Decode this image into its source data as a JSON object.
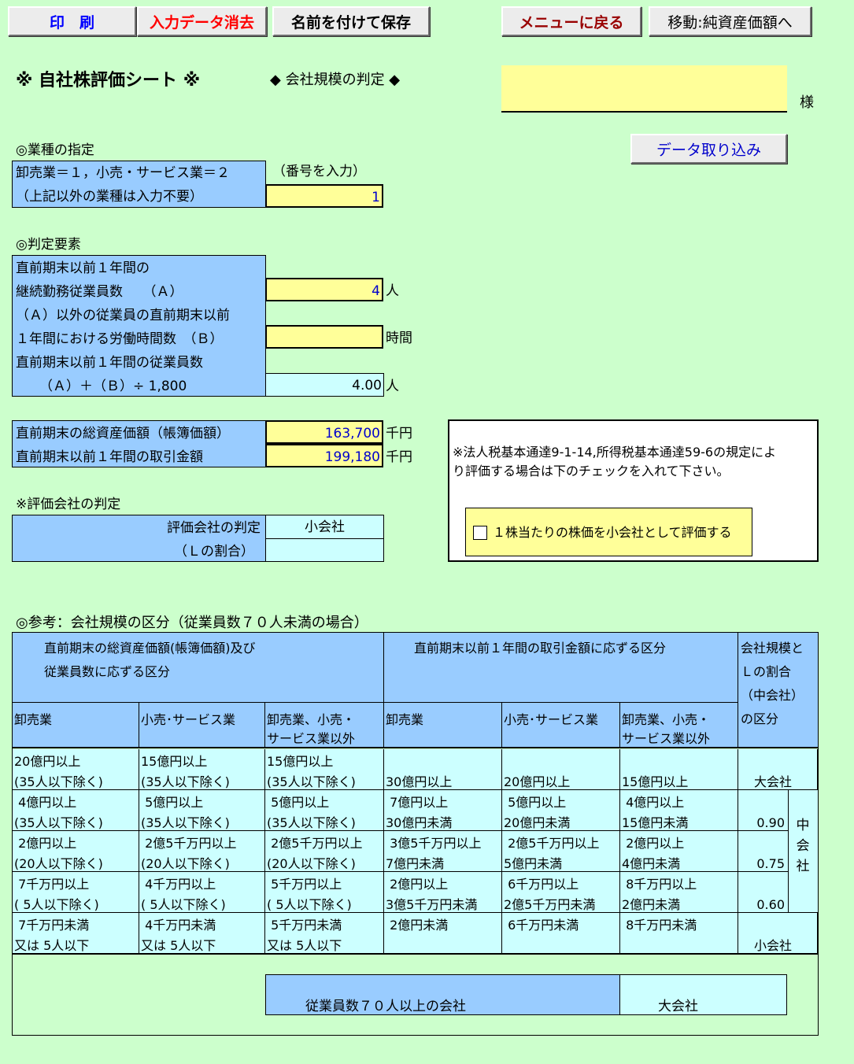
{
  "toolbar": {
    "print": "印　刷",
    "clear": "入力データ消去",
    "save_as": "名前を付けて保存",
    "menu": "メニューに戻る",
    "move": "移動:純資産価額へ"
  },
  "header": {
    "title": "※ 自社株評価シート ※",
    "subtitle": "◆ 会社規模の判定 ◆",
    "company_name_value": "",
    "honorific": "様"
  },
  "import_button": "データ取り込み",
  "industry": {
    "heading": "◎業種の指定",
    "label_line1": "卸売業＝１，小売・サービス業＝２",
    "label_line2": "（上記以外の業種は入力不要）",
    "hint": "（番号を入力）",
    "value": "1"
  },
  "factors": {
    "heading": "◎判定要素",
    "a_line1": "直前期末以前１年間の",
    "a_line2": "継続勤務従業員数　　（Ａ）",
    "a_value": "4",
    "a_unit": "人",
    "b_line1": "（Ａ）以外の従業員の直前期末以前",
    "b_line2": "１年間における労働時間数　（Ｂ）",
    "b_value": "",
    "b_unit": "時間",
    "c_line1": "直前期末以前１年間の従業員数",
    "c_line2": "（Ａ）＋（Ｂ）÷ 1,800",
    "c_value": "4.00",
    "c_unit": "人"
  },
  "amounts": {
    "assets_label": "直前期末の総資産価額（帳簿価額）",
    "assets_value": "163,700",
    "assets_unit": "千円",
    "sales_label": "直前期末以前１年間の取引金額",
    "sales_value": "199,180",
    "sales_unit": "千円"
  },
  "notice": {
    "text_line1": "※法人税基本通達9-1-14,所得税基本通達59-6の規定によ",
    "text_line2": "り評価する場合は下のチェックを入れて下さい。",
    "checkbox_label": "１株当たりの株価を小会社として評価する",
    "checked": false
  },
  "result": {
    "heading": "※評価会社の判定",
    "judgement_label": "評価会社の判定",
    "judgement_value": "小会社",
    "ratio_label": "（Ｌの割合）",
    "ratio_value": ""
  },
  "reference": {
    "heading": "◎参考：会社規模の区分（従業員数７０人未満の場合）",
    "group1_line1": "直前期末の総資産価額(帳簿価額)及び",
    "group1_line2": "従業員数に応ずる区分",
    "group2": "直前期末以前１年間の取引金額に応ずる区分",
    "group3_line1": "会社規模と",
    "group3_line2": "Ｌの割合",
    "group3_line3": "（中会社）",
    "group3_line4": "の区分",
    "sub_headers": [
      [
        "卸売業",
        ""
      ],
      [
        "小売･サービス業",
        ""
      ],
      [
        "卸売業、小売・",
        "サービス業以外"
      ],
      [
        "卸売業",
        ""
      ],
      [
        "小売･サービス業",
        ""
      ],
      [
        "卸売業、小売・",
        "サービス業以外"
      ]
    ],
    "rows": [
      {
        "cells": [
          [
            "20億円以上",
            "(35人以下除く)"
          ],
          [
            "15億円以上",
            "(35人以下除く)"
          ],
          [
            "15億円以上",
            "(35人以下除く)"
          ],
          [
            "",
            "30億円以上"
          ],
          [
            "",
            "20億円以上"
          ],
          [
            "",
            "15億円以上"
          ]
        ],
        "size": "大会社",
        "ratio": ""
      },
      {
        "cells": [
          [
            " 4億円以上",
            "(35人以下除く)"
          ],
          [
            " 5億円以上",
            "(35人以下除く)"
          ],
          [
            " 5億円以上",
            "(35人以下除く)"
          ],
          [
            " 7億円以上",
            "30億円未満"
          ],
          [
            " 5億円以上",
            "20億円未満"
          ],
          [
            " 4億円以上",
            "15億円未満"
          ]
        ],
        "size": "",
        "ratio": "0.90"
      },
      {
        "cells": [
          [
            " 2億円以上",
            "(20人以下除く)"
          ],
          [
            " 2億5千万円以上",
            "(20人以下除く)"
          ],
          [
            " 2億5千万円以上",
            "(20人以下除く)"
          ],
          [
            " 3億5千万円以上",
            "7億円未満"
          ],
          [
            " 2億5千万円以上",
            "5億円未満"
          ],
          [
            " 2億円以上",
            "4億円未満"
          ]
        ],
        "size": "",
        "ratio": "0.75"
      },
      {
        "cells": [
          [
            " 7千万円以上",
            "( 5人以下除く)"
          ],
          [
            " 4千万円以上",
            "( 5人以下除く)"
          ],
          [
            " 5千万円以上",
            "( 5人以下除く)"
          ],
          [
            " 2億円以上",
            "3億5千万円未満"
          ],
          [
            " 6千万円以上",
            "2億5千万円未満"
          ],
          [
            " 8千万円以上",
            "2億円未満"
          ]
        ],
        "size": "",
        "ratio": "0.60"
      },
      {
        "cells": [
          [
            " 7千万円未満",
            "又は 5人以下"
          ],
          [
            " 4千万円未満",
            "又は 5人以下"
          ],
          [
            " 5千万円未満",
            "又は 5人以下"
          ],
          [
            " 2億円未満",
            ""
          ],
          [
            " 6千万円未満",
            ""
          ],
          [
            " 8千万円未満",
            ""
          ]
        ],
        "size": "小会社",
        "ratio": ""
      }
    ],
    "middle_label": "中会社",
    "over70_label": "従業員数７０人以上の会社",
    "over70_value": "大会社"
  }
}
